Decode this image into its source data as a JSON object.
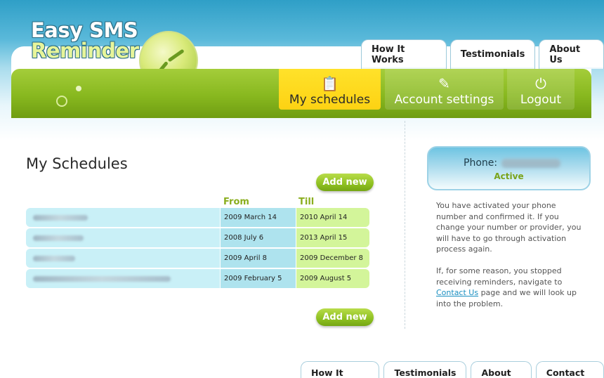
{
  "logo": {
    "line1": "Easy SMS",
    "line2": "Reminder"
  },
  "top_tabs": [
    "How It Works",
    "Testimonials",
    "About Us"
  ],
  "nav": {
    "items": [
      {
        "label": "My schedules",
        "icon": "schedule-icon",
        "active": true
      },
      {
        "label": "Account settings",
        "icon": "settings-clipboard-icon",
        "active": false
      },
      {
        "label": "Logout",
        "icon": "power-icon",
        "active": false
      }
    ]
  },
  "main": {
    "title": "My Schedules",
    "add_new_label": "Add new",
    "columns": {
      "from": "From",
      "till": "Till"
    },
    "rows": [
      {
        "from": "2009 March 14",
        "till": "2010 April 14"
      },
      {
        "from": "2008 July 6",
        "till": "2013 April 15"
      },
      {
        "from": "2009 April 8",
        "till": "2009 December 8"
      },
      {
        "from": "2009 February 5",
        "till": "2009 August 5"
      }
    ]
  },
  "sidebar": {
    "phone_label": "Phone:",
    "status": "Active",
    "info1": "You have activated your phone number and confirmed it. If you change your number or provider, you will have to go through activation process again.",
    "info2_before": "If, for some reason, you stopped receiving reminders, navigate to",
    "info2_link": "Contact Us",
    "info2_after": "page and we will look up into the problem."
  },
  "footer_tabs": [
    "How It Works",
    "Testimonials",
    "About Us",
    "Contact Us"
  ],
  "colors": {
    "nav_green": "#88b81f",
    "active_tab": "#fdd213",
    "accent_green": "#8aae1e",
    "link": "#1a8fc1"
  }
}
